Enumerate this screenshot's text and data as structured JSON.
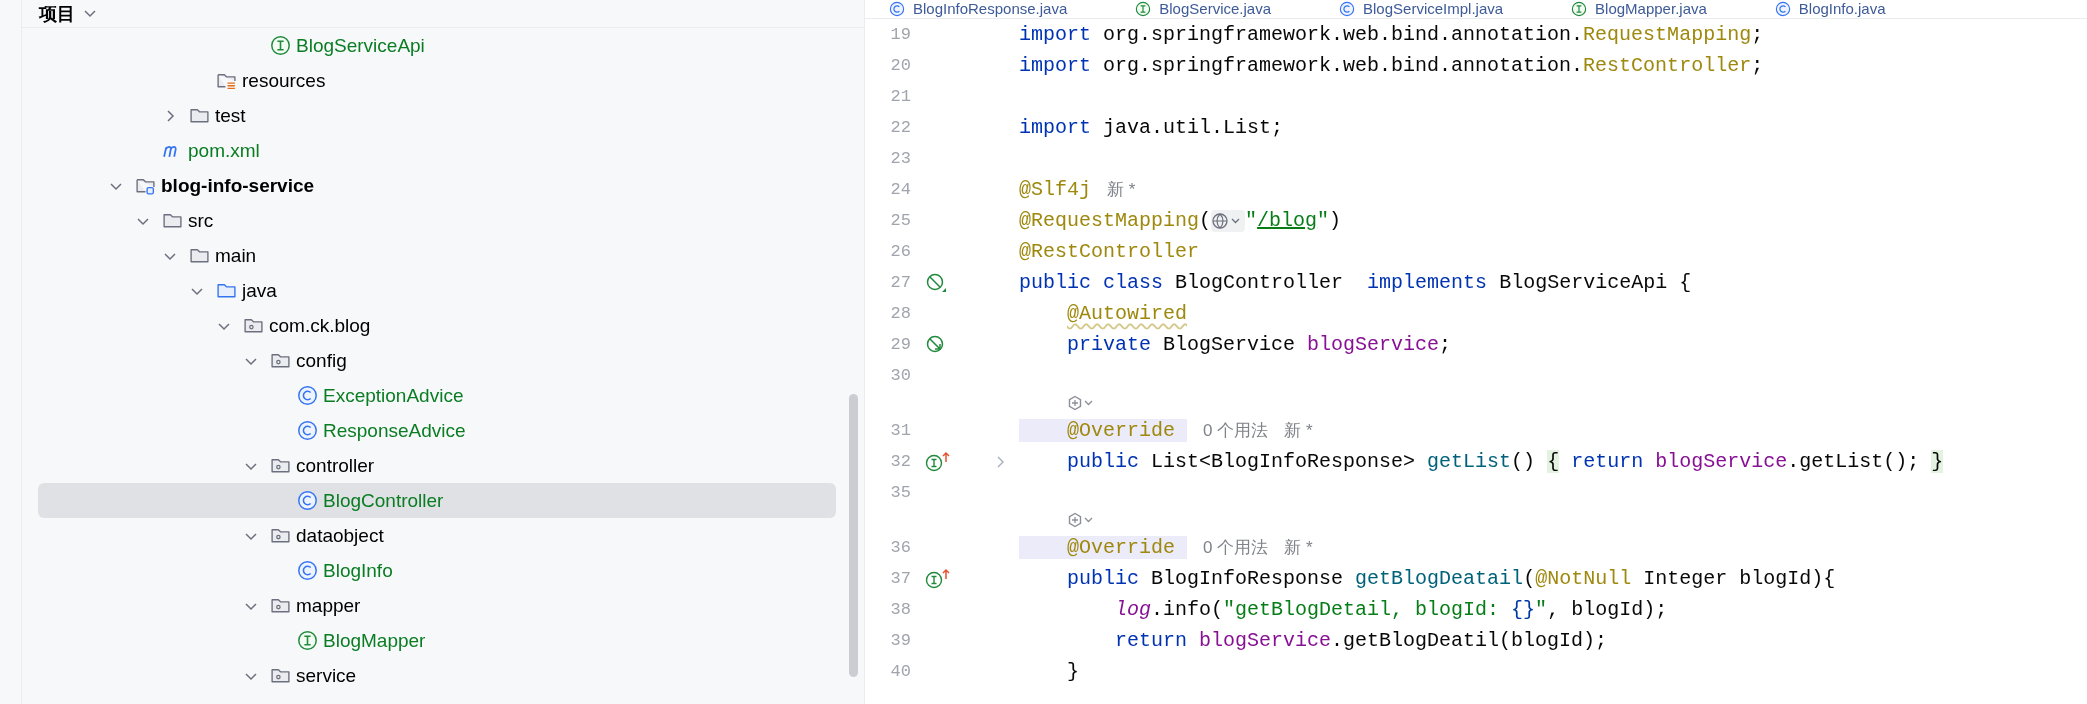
{
  "tree": {
    "title": "项目",
    "items": [
      {
        "children": [
          {
            "children": [
              {
                "children": [
                  {
                    "children": [
                      {
                        "children": [
                          {
                            "label": "BlogServiceApi",
                            "kind": "interface",
                            "added": true,
                            "selected": false
                          }
                        ]
                      }
                    ]
                  },
                  {
                    "label": "resources",
                    "kind": "resource-folder",
                    "added": false,
                    "selected": false
                  }
                ]
              },
              {
                "label": "test",
                "kind": "folder",
                "expanded": false,
                "added": false,
                "selected": false
              }
            ]
          },
          {
            "label": "pom.xml",
            "kind": "maven",
            "added": true,
            "selected": false
          }
        ]
      },
      {
        "label": "blog-info-service",
        "kind": "module",
        "expanded": true,
        "added": false,
        "selected": false,
        "children": [
          {
            "label": "src",
            "kind": "folder",
            "expanded": true,
            "added": false,
            "selected": false,
            "children": [
              {
                "label": "main",
                "kind": "folder",
                "expanded": true,
                "added": false,
                "selected": false,
                "children": [
                  {
                    "label": "java",
                    "kind": "source-folder",
                    "expanded": true,
                    "added": false,
                    "selected": false,
                    "children": [
                      {
                        "label": "com.ck.blog",
                        "kind": "package",
                        "expanded": true,
                        "added": false,
                        "selected": false,
                        "children": [
                          {
                            "label": "config",
                            "kind": "package",
                            "expanded": true,
                            "added": false,
                            "selected": false,
                            "children": [
                              {
                                "label": "ExceptionAdvice",
                                "kind": "class",
                                "added": true,
                                "selected": false
                              },
                              {
                                "label": "ResponseAdvice",
                                "kind": "class",
                                "added": true,
                                "selected": false
                              }
                            ]
                          },
                          {
                            "label": "controller",
                            "kind": "package",
                            "expanded": true,
                            "added": false,
                            "selected": false,
                            "children": [
                              {
                                "label": "BlogController",
                                "kind": "class",
                                "added": true,
                                "selected": true
                              }
                            ]
                          },
                          {
                            "label": "dataobject",
                            "kind": "package",
                            "expanded": true,
                            "added": false,
                            "selected": false,
                            "children": [
                              {
                                "label": "BlogInfo",
                                "kind": "class",
                                "added": true,
                                "selected": false
                              }
                            ]
                          },
                          {
                            "label": "mapper",
                            "kind": "package",
                            "expanded": true,
                            "added": false,
                            "selected": false,
                            "children": [
                              {
                                "label": "BlogMapper",
                                "kind": "interface",
                                "added": true,
                                "selected": false
                              }
                            ]
                          },
                          {
                            "label": "service",
                            "kind": "package",
                            "expanded": true,
                            "added": false,
                            "selected": false
                          }
                        ]
                      }
                    ]
                  }
                ]
              }
            ]
          }
        ]
      }
    ]
  },
  "tabs": [
    {
      "label": "BlogInfoResponse.java",
      "kind": "class"
    },
    {
      "label": "BlogService.java",
      "kind": "interface"
    },
    {
      "label": "BlogServiceImpl.java",
      "kind": "class"
    },
    {
      "label": "BlogMapper.java",
      "kind": "interface"
    },
    {
      "label": "BlogInfo.java",
      "kind": "class"
    }
  ],
  "editor": {
    "lines": [
      {
        "kind": "code",
        "number": "19",
        "folded": false,
        "segments": [
          {
            "kind": "keyword",
            "text": "import"
          },
          {
            "kind": "plain",
            "text": " org.springframework.web.bind.annotation."
          },
          {
            "kind": "annotation",
            "text": "RequestMapping"
          },
          {
            "kind": "plain",
            "text": ";"
          }
        ]
      },
      {
        "kind": "code",
        "number": "20",
        "folded": false,
        "segments": [
          {
            "kind": "keyword",
            "text": "import"
          },
          {
            "kind": "plain",
            "text": " org.springframework.web.bind.annotation."
          },
          {
            "kind": "annotation",
            "text": "RestController"
          },
          {
            "kind": "plain",
            "text": ";"
          }
        ]
      },
      {
        "kind": "code",
        "number": "21",
        "folded": false
      },
      {
        "kind": "code",
        "number": "22",
        "folded": false,
        "segments": [
          {
            "kind": "keyword",
            "text": "import"
          },
          {
            "kind": "plain",
            "text": " java.util.List;"
          }
        ]
      },
      {
        "kind": "code",
        "number": "23",
        "folded": false
      },
      {
        "kind": "code",
        "number": "24",
        "folded": false,
        "segments": [
          {
            "kind": "annotation",
            "text": "@Slf4j"
          }
        ],
        "hints": [
          "新 *"
        ]
      },
      {
        "kind": "code",
        "number": "25",
        "folded": false,
        "segments": [
          {
            "kind": "annotation",
            "text": "@RequestMapping"
          },
          {
            "kind": "plain",
            "text": "("
          },
          {
            "kind": "globe"
          },
          {
            "kind": "string",
            "text": "\""
          },
          {
            "kind": "link",
            "text": "/blog"
          },
          {
            "kind": "string",
            "text": "\""
          },
          {
            "kind": "plain",
            "text": ")"
          }
        ]
      },
      {
        "kind": "code",
        "number": "26",
        "folded": false,
        "segments": [
          {
            "kind": "annotation",
            "text": "@RestController"
          }
        ]
      },
      {
        "kind": "code",
        "number": "27",
        "folded": false,
        "gutter": {
          "kind": "bean"
        },
        "segments": [
          {
            "kind": "keyword",
            "text": "public class"
          },
          {
            "kind": "plain",
            "text": " BlogController  "
          },
          {
            "kind": "keyword",
            "text": "implements"
          },
          {
            "kind": "plain",
            "text": " BlogServiceApi {"
          }
        ]
      },
      {
        "kind": "code",
        "number": "28",
        "folded": false,
        "segments": [
          {
            "kind": "annotation-warn",
            "text": "    @Autowired"
          }
        ]
      },
      {
        "kind": "code",
        "number": "29",
        "folded": false,
        "gutter": {
          "kind": "bean-inject"
        },
        "segments": [
          {
            "kind": "keyword",
            "text": "    private"
          },
          {
            "kind": "plain",
            "text": " BlogService "
          },
          {
            "kind": "field",
            "text": "blogService"
          },
          {
            "kind": "plain",
            "text": ";"
          }
        ]
      },
      {
        "kind": "code",
        "number": "30",
        "folded": false
      },
      {
        "kind": "hint-row"
      },
      {
        "kind": "code",
        "number": "31",
        "folded": false,
        "segments": [
          {
            "kind": "annotation-marked",
            "text": "    @Override "
          }
        ],
        "hints": [
          "0 个用法",
          "新 *"
        ]
      },
      {
        "kind": "code",
        "number": "32",
        "folded": true,
        "gutter": {
          "kind": "implements"
        },
        "segments": [
          {
            "kind": "keyword",
            "text": "    public"
          },
          {
            "kind": "plain",
            "text": " List<BlogInfoResponse> "
          },
          {
            "kind": "method",
            "text": "getList"
          },
          {
            "kind": "plain",
            "text": "()"
          },
          {
            "kind": "brace-match",
            "text": " {"
          },
          {
            "kind": "keyword",
            "text": " return"
          },
          {
            "kind": "field",
            "text": " blogService"
          },
          {
            "kind": "plain",
            "text": ".getList(); "
          },
          {
            "kind": "brace-match",
            "text": "}"
          }
        ]
      },
      {
        "kind": "code",
        "number": "35",
        "folded": false
      },
      {
        "kind": "hint-row"
      },
      {
        "kind": "code",
        "number": "36",
        "folded": false,
        "segments": [
          {
            "kind": "annotation-marked",
            "text": "    @Override "
          }
        ],
        "hints": [
          "0 个用法",
          "新 *"
        ]
      },
      {
        "kind": "code",
        "number": "37",
        "folded": false,
        "gutter": {
          "kind": "implements"
        },
        "segments": [
          {
            "kind": "keyword",
            "text": "    public"
          },
          {
            "kind": "plain",
            "text": " BlogInfoResponse "
          },
          {
            "kind": "method",
            "text": "getBlogDeatail"
          },
          {
            "kind": "plain",
            "text": "("
          },
          {
            "kind": "annotation",
            "text": "@NotNull"
          },
          {
            "kind": "plain",
            "text": " Integer blogId){"
          }
        ]
      },
      {
        "kind": "code",
        "number": "38",
        "folded": false,
        "segments": [
          {
            "kind": "static-field",
            "text": "        log"
          },
          {
            "kind": "plain",
            "text": ".info("
          },
          {
            "kind": "string",
            "text": "\"getBlogDetail, blogId: "
          },
          {
            "kind": "format",
            "text": "{}"
          },
          {
            "kind": "string",
            "text": "\""
          },
          {
            "kind": "plain",
            "text": ", blogId);"
          }
        ]
      },
      {
        "kind": "code",
        "number": "39",
        "folded": false,
        "segments": [
          {
            "kind": "keyword",
            "text": "        return"
          },
          {
            "kind": "field",
            "text": " blogService"
          },
          {
            "kind": "plain",
            "text": ".getBlogDeatil(blogId);"
          }
        ]
      },
      {
        "kind": "code",
        "number": "40",
        "folded": false,
        "segments": [
          {
            "kind": "plain",
            "text": "    }"
          }
        ]
      }
    ]
  }
}
